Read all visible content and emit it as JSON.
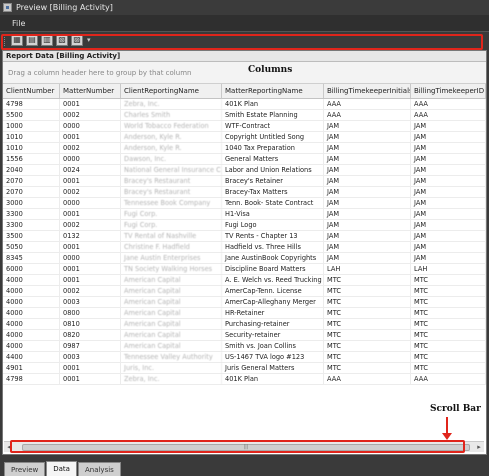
{
  "window": {
    "title": "Preview [Billing Activity]"
  },
  "menu": {
    "file": "File"
  },
  "toolbar": {
    "icons": [
      "grid-icon",
      "export-icon",
      "print-icon",
      "image-icon",
      "pdf-icon"
    ]
  },
  "panel": {
    "title": "Report Data [Billing Activity]",
    "group_hint": "Drag a column header here to group by that column"
  },
  "annotations": {
    "columns": "Columns",
    "scroll_bar": "Scroll Bar"
  },
  "grid": {
    "columns": [
      "ClientNumber",
      "MatterNumber",
      "ClientReportingName",
      "MatterReportingName",
      "BillingTimekeeperInitials",
      "BillingTimekeeperID"
    ],
    "rows": [
      [
        "4798",
        "0001",
        "Zebra, Inc.",
        "401K Plan",
        "AAA",
        "AAA"
      ],
      [
        "5500",
        "0002",
        "Charles Smith",
        "Smith Estate Planning",
        "AAA",
        "AAA"
      ],
      [
        "1000",
        "0000",
        "World Tobacco Federation",
        "WTF-Contract",
        "JAM",
        "JAM"
      ],
      [
        "1010",
        "0001",
        "Anderson, Kyle R.",
        "Copyright Untitled Song",
        "JAM",
        "JAM"
      ],
      [
        "1010",
        "0002",
        "Anderson, Kyle R.",
        "1040 Tax Preparation",
        "JAM",
        "JAM"
      ],
      [
        "1556",
        "0000",
        "Dawson, Inc.",
        "General Matters",
        "JAM",
        "JAM"
      ],
      [
        "2040",
        "0024",
        "National General Insurance Co.",
        "Labor and Union Relations",
        "JAM",
        "JAM"
      ],
      [
        "2070",
        "0001",
        "Bracey's Restaurant",
        "Bracey's Retainer",
        "JAM",
        "JAM"
      ],
      [
        "2070",
        "0002",
        "Bracey's Restaurant",
        "Bracey-Tax Matters",
        "JAM",
        "JAM"
      ],
      [
        "3000",
        "0000",
        "Tennessee Book Company",
        "Tenn. Book- State Contract",
        "JAM",
        "JAM"
      ],
      [
        "3300",
        "0001",
        "Fugi Corp.",
        "H1-Visa",
        "JAM",
        "JAM"
      ],
      [
        "3300",
        "0002",
        "Fugi Corp.",
        "Fugi Logo",
        "JAM",
        "JAM"
      ],
      [
        "3500",
        "0132",
        "TV Rental of Nashville",
        "TV Rents - Chapter 13",
        "JAM",
        "JAM"
      ],
      [
        "5050",
        "0001",
        "Christine F. Hadfield",
        "Hadfield vs. Three Hills",
        "JAM",
        "JAM"
      ],
      [
        "8345",
        "0000",
        "Jane Austin Enterprises",
        "Jane AustinBook Copyrights",
        "JAM",
        "JAM"
      ],
      [
        "6000",
        "0001",
        "TN Society Walking Horses",
        "Discipline Board Matters",
        "LAH",
        "LAH"
      ],
      [
        "4000",
        "0001",
        "American Capital",
        "A. E. Welch vs. Reed Trucking",
        "MTC",
        "MTC"
      ],
      [
        "4000",
        "0002",
        "American Capital",
        "AmerCap-Tenn. License",
        "MTC",
        "MTC"
      ],
      [
        "4000",
        "0003",
        "American Capital",
        "AmerCap-Alleghany Merger",
        "MTC",
        "MTC"
      ],
      [
        "4000",
        "0800",
        "American Capital",
        "HR-Retainer",
        "MTC",
        "MTC"
      ],
      [
        "4000",
        "0810",
        "American Capital",
        "Purchasing-retainer",
        "MTC",
        "MTC"
      ],
      [
        "4000",
        "0820",
        "American Capital",
        "Security-retainer",
        "MTC",
        "MTC"
      ],
      [
        "4000",
        "0987",
        "American Capital",
        "Smith vs. Joan Collins",
        "MTC",
        "MTC"
      ],
      [
        "4400",
        "0003",
        "Tennessee Valley Authority",
        "US-1467 TVA logo #123",
        "MTC",
        "MTC"
      ],
      [
        "4901",
        "0001",
        "Juris, Inc.",
        "Juris General Matters",
        "MTC",
        "MTC"
      ],
      [
        "4798",
        "0001",
        "Zebra, Inc.",
        "401K Plan",
        "AAA",
        "AAA"
      ]
    ]
  },
  "tabs": [
    "Preview",
    "Data",
    "Analysis"
  ],
  "active_tab": "Data",
  "colors": {
    "highlight": "#e0251b",
    "chrome": "#3a3a3a"
  }
}
